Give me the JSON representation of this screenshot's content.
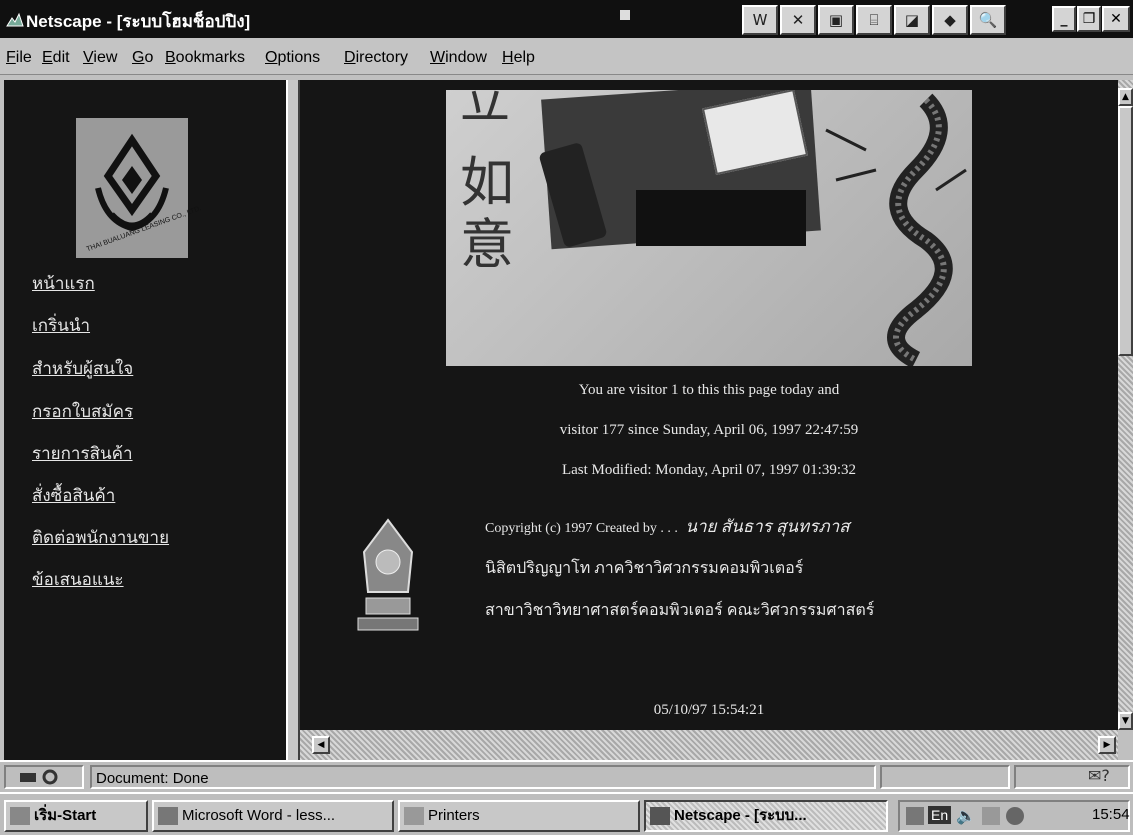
{
  "window": {
    "title": "Netscape - [ระบบโฮมช็อปปิง]",
    "toolbar_icons": [
      "word-icon",
      "excel-icon",
      "powerpoint-icon",
      "access-icon",
      "schedule-icon",
      "bookbinder-icon",
      "find-icon"
    ]
  },
  "menu": {
    "items": [
      {
        "u": "F",
        "rest": "ile"
      },
      {
        "u": "E",
        "rest": "dit"
      },
      {
        "u": "V",
        "rest": "iew"
      },
      {
        "u": "G",
        "rest": "o"
      },
      {
        "u": "B",
        "rest": "ookmarks"
      },
      {
        "u": "O",
        "rest": "ptions"
      },
      {
        "u": "D",
        "rest": "irectory"
      },
      {
        "u": "W",
        "rest": "indow"
      },
      {
        "u": "H",
        "rest": "elp"
      }
    ]
  },
  "left_frame": {
    "logo_text": "THAI BUALUANG LEASING CO., LTD.",
    "links": [
      "หน้าแรก",
      "เกริ่นนำ",
      "สำหรับผู้สนใจ",
      "กรอกใบสมัคร",
      "รายการสินค้า",
      "สั่งซื้อสินค้า",
      "ติดต่อพนักงานขาย",
      "ข้อเสนอแนะ"
    ]
  },
  "content": {
    "banner_glyphs": [
      "如",
      "意"
    ],
    "visitor_today": "You are visitor 1 to this this page today and",
    "visitor_total": "visitor 177 since Sunday, April 06, 1997 22:47:59",
    "last_modified": "Last Modified: Monday, April 07, 1997 01:39:32",
    "copyright_prefix": "Copyright (c) 1997 Created by . . .",
    "author": "นาย สันธาร สุนทรภาส",
    "degree": "นิสิตปริญญาโท ภาควิชาวิศวกรรมคอมพิวเตอร์",
    "department": "สาขาวิชาวิทยาศาสตร์คอมพิวเตอร์ คณะวิศวกรรมศาสตร์",
    "timestamp": "05/10/97 15:54:21"
  },
  "status": {
    "text": "Document: Done"
  },
  "taskbar": {
    "start_label": "เริ่ม-Start",
    "tasks": [
      "Microsoft Word - less...",
      "Printers",
      "Netscape - [ระบบ..."
    ],
    "tray_lang": "En",
    "clock": "15:54"
  }
}
